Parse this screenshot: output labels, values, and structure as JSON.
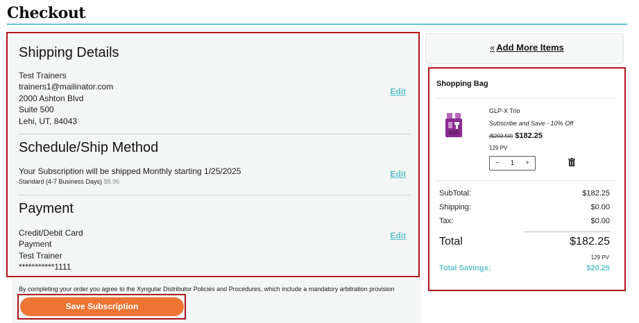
{
  "page": {
    "title": "Checkout"
  },
  "shipping": {
    "title": "Shipping Details",
    "name": "Test Trainers",
    "email": "trainers1@mailinator.com",
    "address1": "2000 Ashton Blvd",
    "address2": "Suite 500",
    "city_state_zip": "Lehi, UT, 84043",
    "edit_label": "Edit"
  },
  "schedule": {
    "title": "Schedule/Ship Method",
    "subscription_text": "Your Subscription will be shipped Monthly starting 1/25/2025",
    "method": "Standard (4-7 Business Days)",
    "method_price": "$8.95",
    "edit_label": "Edit"
  },
  "payment": {
    "title": "Payment",
    "type": "Credit/Debit Card",
    "label": "Payment",
    "holder": "Test Trainer",
    "card_number": "***********1111",
    "edit_label": "Edit"
  },
  "agreement": "By completing your order you agree to the Xyngular Distributor Policies and Procedures, which include a mandatory arbitration provision",
  "save_button": "Save Subscription",
  "add_more": {
    "chevron": "«",
    "label": "Add More Items"
  },
  "bag": {
    "title": "Shopping Bag",
    "item": {
      "name": "GLP-X Trio",
      "plan": "Subscribe and Save - 10% Off",
      "original_price": "($202.50)",
      "price": "$182.25",
      "pv": "129 PV",
      "quantity": "1",
      "minus": "−",
      "plus": "+"
    },
    "subtotal_label": "SubTotal:",
    "subtotal": "$182.25",
    "shipping_label": "Shipping:",
    "shipping": "$0.00",
    "tax_label": "Tax:",
    "tax": "$0.00",
    "total_label": "Total",
    "total": "$182.25",
    "total_pv": "129 PV",
    "savings_label": "Total Savings:",
    "savings": "$20.25"
  },
  "colors": {
    "accent_teal": "#5cc3c9",
    "button_orange": "#ed7432",
    "highlight_red": "#b0121b",
    "product_purple": "#8a2a8f"
  },
  "icons": {
    "trash": "trash-icon",
    "chevron": "double-chevron-left-icon"
  }
}
